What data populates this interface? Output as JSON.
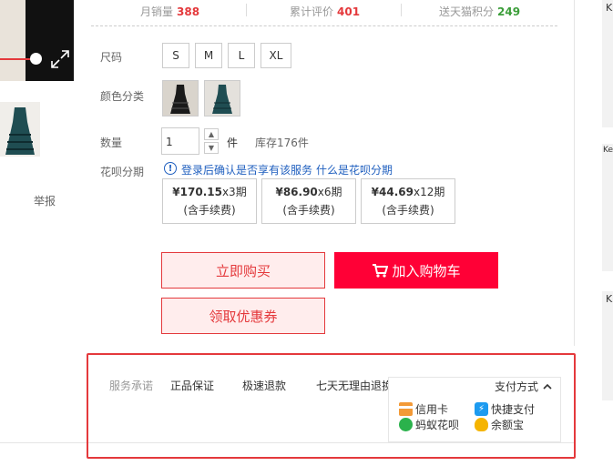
{
  "stats": {
    "monthly_sales_label": "月销量",
    "monthly_sales_value": "388",
    "reviews_label": "累计评价",
    "reviews_value": "401",
    "points_label": "送天猫积分",
    "points_value": "249"
  },
  "size": {
    "label": "尺码",
    "options": [
      "S",
      "M",
      "L",
      "XL"
    ]
  },
  "color": {
    "label": "颜色分类"
  },
  "quantity": {
    "label": "数量",
    "value": "1",
    "unit": "件",
    "stock": "库存176件"
  },
  "huabei": {
    "label": "花呗分期",
    "notice": "登录后确认是否享有该服务",
    "link": "什么是花呗分期",
    "plans": [
      {
        "amount": "¥170.15",
        "period": "x3期",
        "fee": "(含手续费)"
      },
      {
        "amount": "¥86.90",
        "period": "x6期",
        "fee": "(含手续费)"
      },
      {
        "amount": "¥44.69",
        "period": "x12期",
        "fee": "(含手续费)"
      }
    ]
  },
  "actions": {
    "buy_now": "立即购买",
    "add_cart": "加入购物车",
    "get_coupon": "领取优惠券"
  },
  "report": "举报",
  "service": {
    "label": "服务承诺",
    "items": [
      "正品保证",
      "极速退款",
      "七天无理由退换"
    ]
  },
  "payment": {
    "title": "支付方式",
    "options": [
      "信用卡",
      "快捷支付",
      "蚂蚁花呗",
      "余额宝"
    ]
  },
  "right_strip": {
    "letters": [
      "K",
      "Kea",
      "K"
    ]
  },
  "colors": {
    "accent": "#e4393c",
    "cart_bg": "#ff0036",
    "points_green": "#3c9e3a",
    "link_blue": "#1f5fbf"
  }
}
